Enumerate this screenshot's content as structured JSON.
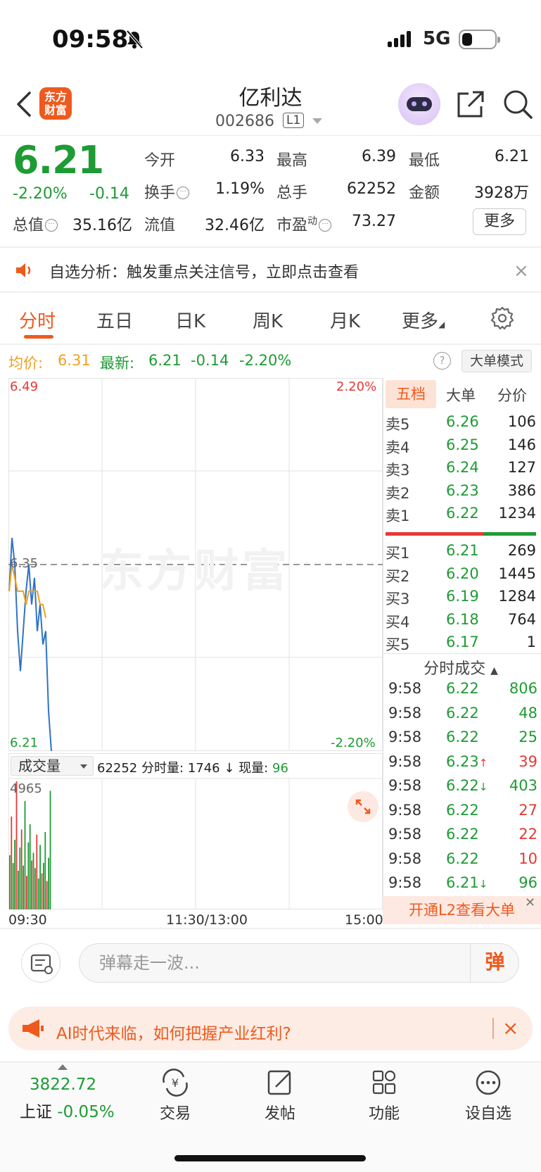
{
  "status_bar": {
    "time": "09:58",
    "network": "5G"
  },
  "header": {
    "logo_text": "东方财富",
    "title": "亿利达",
    "code": "002686",
    "level": "L1"
  },
  "quote": {
    "price": "6.21",
    "change_pct": "-2.20%",
    "change": "-0.14",
    "fields": [
      {
        "label": "今开",
        "value": "6.33",
        "color": "green"
      },
      {
        "label": "最高",
        "value": "6.39",
        "color": "red"
      },
      {
        "label": "最低",
        "value": "6.21",
        "color": "green"
      },
      {
        "label": "换手",
        "value": "1.19%",
        "color": "normal"
      },
      {
        "label": "总手",
        "value": "62252",
        "color": "normal"
      },
      {
        "label": "金额",
        "value": "3928万",
        "color": "normal"
      },
      {
        "label": "总值",
        "value": "35.16亿",
        "color": "normal"
      },
      {
        "label": "流值",
        "value": "32.46亿",
        "color": "normal"
      },
      {
        "label": "市盈",
        "value": "73.27",
        "color": "normal"
      }
    ],
    "pe_sup": "动",
    "more_button": "更多"
  },
  "notice": {
    "text": "自选分析：触发重点关注信号，立即点击查看",
    "close": "×"
  },
  "tabs": [
    "分时",
    "五日",
    "日K",
    "周K",
    "月K",
    "更多"
  ],
  "summary": {
    "avg_label": "均价:",
    "avg_value": "6.31",
    "latest_label": "最新:",
    "latest_value": "6.21",
    "latest_change": "-0.14",
    "latest_pct": "-2.20%",
    "help": "?",
    "big_order_mode": "大单模式"
  },
  "chart": {
    "y_top": "6.49",
    "y_bottom": "6.21",
    "pct_top": "2.20%",
    "pct_bottom": "-2.20%",
    "mid_price": "6.35",
    "watermark": "东方财富",
    "x_start": "09:30",
    "x_mid": "11:30/13:00",
    "x_end": "15:00"
  },
  "volume": {
    "selector": "成交量",
    "total": "62252",
    "minute_label": "分时量:",
    "minute_value": "1746",
    "arrow": "↓",
    "now_label": "现量:",
    "now_value": "96",
    "max_label": "4965"
  },
  "order_book": {
    "tabs": [
      "五档",
      "大单",
      "分价"
    ],
    "asks": [
      {
        "label": "卖5",
        "price": "6.26",
        "vol": "106"
      },
      {
        "label": "卖4",
        "price": "6.25",
        "vol": "146"
      },
      {
        "label": "卖3",
        "price": "6.24",
        "vol": "127"
      },
      {
        "label": "卖2",
        "price": "6.23",
        "vol": "386"
      },
      {
        "label": "卖1",
        "price": "6.22",
        "vol": "1234"
      }
    ],
    "bids": [
      {
        "label": "买1",
        "price": "6.21",
        "vol": "269"
      },
      {
        "label": "买2",
        "price": "6.20",
        "vol": "1445"
      },
      {
        "label": "买3",
        "price": "6.19",
        "vol": "1284"
      },
      {
        "label": "买4",
        "price": "6.18",
        "vol": "764"
      },
      {
        "label": "买5",
        "price": "6.17",
        "vol": "1"
      }
    ]
  },
  "trades": {
    "title": "分时成交",
    "rows": [
      {
        "time": "9:58",
        "price": "6.22",
        "arrow": "",
        "vol": "806",
        "dir": "buy"
      },
      {
        "time": "9:58",
        "price": "6.22",
        "arrow": "",
        "vol": "48",
        "dir": "buy"
      },
      {
        "time": "9:58",
        "price": "6.22",
        "arrow": "",
        "vol": "25",
        "dir": "buy"
      },
      {
        "time": "9:58",
        "price": "6.23",
        "arrow": "↑",
        "vol": "39",
        "dir": "sell"
      },
      {
        "time": "9:58",
        "price": "6.22",
        "arrow": "↓",
        "vol": "403",
        "dir": "buy"
      },
      {
        "time": "9:58",
        "price": "6.22",
        "arrow": "",
        "vol": "27",
        "dir": "sell"
      },
      {
        "time": "9:58",
        "price": "6.22",
        "arrow": "",
        "vol": "22",
        "dir": "sell"
      },
      {
        "time": "9:58",
        "price": "6.22",
        "arrow": "",
        "vol": "10",
        "dir": "sell"
      },
      {
        "time": "9:58",
        "price": "6.21",
        "arrow": "↓",
        "vol": "96",
        "dir": "buy"
      }
    ],
    "l2_banner": "开通L2查看大单"
  },
  "danmaku": {
    "placeholder": "弹幕走一波...",
    "send": "弹"
  },
  "ai_banner": {
    "text": "AI时代来临，如何把握产业红利?",
    "close": "×"
  },
  "bottom_nav": {
    "index_value": "3822.72",
    "index_name": "上证",
    "index_change": "-0.05%",
    "items": [
      "交易",
      "发帖",
      "功能",
      "设自选"
    ]
  },
  "colors": {
    "accent": "#ee5a1e",
    "up": "#e53935",
    "down": "#1e9b34",
    "avg_line": "#f0a020",
    "price_line": "#2f73c8"
  },
  "chart_data": {
    "type": "line",
    "series": [
      {
        "name": "",
        "values": [
          6.33,
          6.37,
          6.35,
          6.3,
          6.27,
          6.3,
          6.33,
          6.35,
          6.32,
          6.34,
          6.3,
          6.32,
          6.29,
          6.3,
          6.24,
          6.21
        ]
      },
      {
        "name": "均价",
        "values": [
          6.33,
          6.35,
          6.34,
          6.33,
          6.33,
          6.33,
          6.32,
          6.33,
          6.33,
          6.33,
          6.33,
          6.32,
          6.32,
          6.31
        ]
      }
    ],
    "volumes": [
      2100,
      3600,
      1800,
      2700,
      4965,
      1500,
      2400,
      3100,
      1700,
      4200,
      1300,
      2600,
      3300,
      1900,
      2200,
      1600,
      2900,
      1200,
      2500,
      1400,
      1800,
      3000,
      1100,
      2000,
      4600
    ],
    "ylim": [
      6.21,
      6.49
    ],
    "yticks": [
      "6.49",
      "6.21"
    ],
    "right_ticks": [
      "2.20%",
      "-2.20%"
    ],
    "x_ticks": [
      "09:30",
      "11:30/13:00",
      "15:00"
    ],
    "ylim_volume": [
      0,
      4965
    ]
  }
}
